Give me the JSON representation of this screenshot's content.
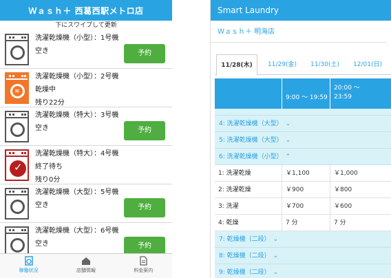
{
  "left": {
    "header_title": "Ｗａｓｈ＋ 西葛西駅メトロ店",
    "pull_hint": "下にスワイプして更新",
    "machines": [
      {
        "name": "洗濯乾燥機（小型）：1号機",
        "status": "空き",
        "sub": "",
        "icon": "washer-idle-icon",
        "button": "予約"
      },
      {
        "name": "洗濯乾燥機（小型）：2号機",
        "status": "乾燥中",
        "sub": "残り22分",
        "icon": "washer-drying-icon",
        "button": ""
      },
      {
        "name": "洗濯乾燥機（特大）：3号機",
        "status": "空き",
        "sub": "",
        "icon": "washer-idle-icon",
        "button": "予約"
      },
      {
        "name": "洗濯乾燥機（特大）：4号機",
        "status": "終了待ち",
        "sub": "残り0分",
        "icon": "washer-done-icon",
        "button": ""
      },
      {
        "name": "洗濯乾燥機（大型）：5号機",
        "status": "空き",
        "sub": "",
        "icon": "washer-idle-icon",
        "button": "予約"
      },
      {
        "name": "洗濯乾燥機（大型）：6号機",
        "status": "空き",
        "sub": "",
        "icon": "washer-idle-icon",
        "button": "予約"
      }
    ],
    "nav": [
      {
        "label": "稼働状況",
        "icon": "washer-status-icon",
        "active": true
      },
      {
        "label": "店舗情報",
        "icon": "store-icon",
        "active": false
      },
      {
        "label": "料金案内",
        "icon": "document-icon",
        "active": false
      }
    ]
  },
  "right": {
    "header_title": "Smart Laundry",
    "store_name": "Ｗａｓｈ＋ 明海店",
    "tabs": [
      "11/28(木)",
      "11/29(金)",
      "11/30(土)",
      "12/01(日)"
    ],
    "active_tab": 0,
    "time_headers": [
      "",
      "9:00 〜 19:59",
      "20:00 〜\n23:59"
    ],
    "categories_top": [
      "4: 洗濯乾燥機（大型）",
      "5: 洗濯乾燥機（大型）",
      "6: 洗濯乾燥機（小型）"
    ],
    "prices": [
      {
        "label": "1: 洗濯乾燥",
        "day": "￥1,100",
        "night": "￥1,000"
      },
      {
        "label": "2: 洗濯乾燥",
        "day": "￥900",
        "night": "￥800"
      },
      {
        "label": "3: 洗濯",
        "day": "￥700",
        "night": "￥600"
      },
      {
        "label": "4: 乾燥",
        "day": "7 分",
        "night": "7 分"
      }
    ],
    "categories_bottom": [
      "7: 乾燥機（二段）",
      "8: 乾燥機（二段）",
      "9: 乾燥機（二段）"
    ]
  },
  "colors": {
    "accent": "#2aa3e3",
    "reserve_green": "#4fae3f",
    "drying_orange": "#f0772a",
    "done_red": "#b5201f",
    "table_bg": "#d8f2f8"
  }
}
